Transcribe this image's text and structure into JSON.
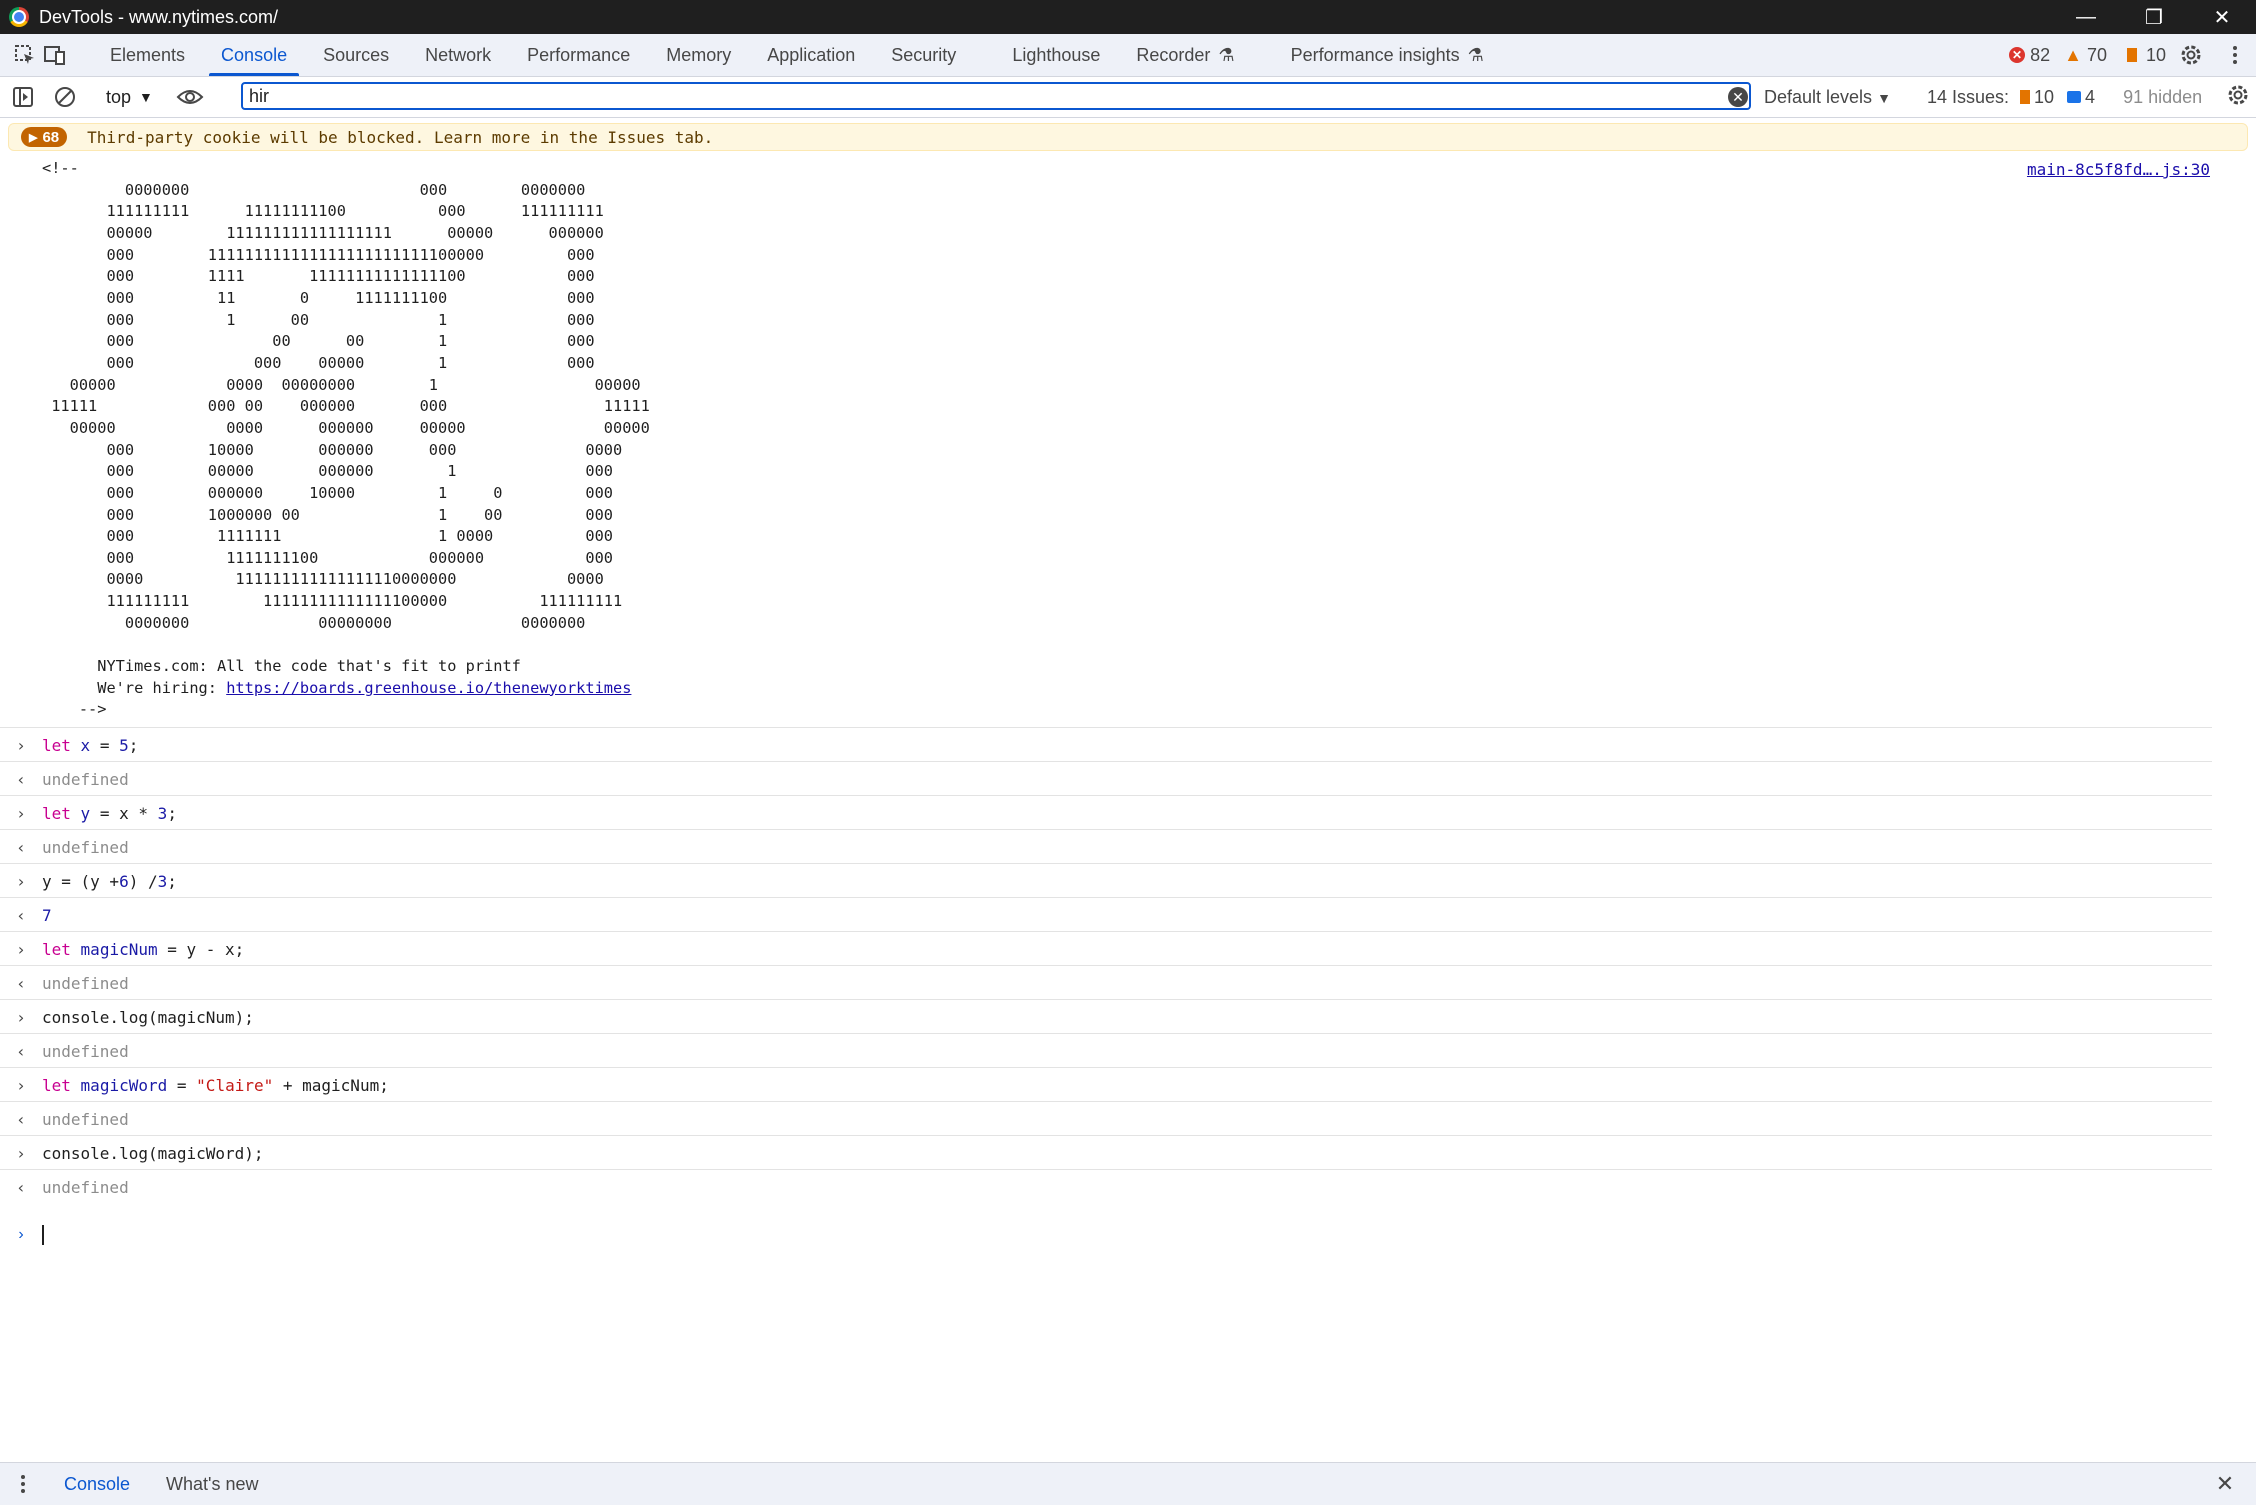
{
  "window": {
    "title": "DevTools - www.nytimes.com/"
  },
  "tabs": [
    "Elements",
    "Console",
    "Sources",
    "Network",
    "Performance",
    "Memory",
    "Application",
    "Security",
    "Lighthouse",
    "Recorder",
    "Performance insights"
  ],
  "active_tab": "Console",
  "counts": {
    "errors": "82",
    "warnings": "70",
    "issues": "10"
  },
  "toolbar": {
    "context": "top",
    "filter_value": "hir",
    "levels": "Default levels",
    "issues_label": "14 Issues:",
    "issues_warn": "10",
    "issues_info": "4",
    "hidden": "91 hidden"
  },
  "warning": {
    "count": "68",
    "text": "Third-party cookie will be blocked. Learn more in the Issues tab."
  },
  "ascii": {
    "lines": [
      "<!--",
      "         0000000                         000        0000000",
      "       111111111      11111111100          000      111111111",
      "       00000        111111111111111111      00000      000000",
      "       000        111111111111111111111111100000         000",
      "       000        1111       11111111111111100           000",
      "       000         11       0     1111111100             000",
      "       000          1      00              1             000",
      "       000               00      00        1             000",
      "       000             000    00000        1             000",
      "   00000            0000  00000000        1                 00000",
      " 11111            000 00    000000       000                 11111",
      "   00000            0000      000000     00000               00000",
      "       000        10000       000000      000              0000",
      "       000        00000       000000        1              000",
      "       000        000000     10000         1     0         000",
      "       000        1000000 00               1    00         000",
      "       000         1111111                 1 0000          000",
      "       000          1111111100            000000           000",
      "       0000          111111111111111110000000            0000",
      "       111111111        11111111111111100000          111111111",
      "         0000000              00000000              0000000",
      "",
      "      NYTimes.com: All the code that's fit to printf",
      "      We're hiring: ",
      "    -->"
    ],
    "hiring_url": "https://boards.greenhouse.io/thenewyorktimes",
    "source": "main-8c5f8fd….js:30"
  },
  "log": [
    {
      "dir": "in",
      "code": "let x = 5;"
    },
    {
      "dir": "out",
      "code": "undefined"
    },
    {
      "dir": "in",
      "code": "let y = x * 3;"
    },
    {
      "dir": "out",
      "code": "undefined"
    },
    {
      "dir": "in",
      "code": "y = (y + 6) / 3;"
    },
    {
      "dir": "out",
      "code": "7"
    },
    {
      "dir": "in",
      "code": "let magicNum = y - x;"
    },
    {
      "dir": "out",
      "code": "undefined"
    },
    {
      "dir": "in",
      "code": "console.log(magicNum);"
    },
    {
      "dir": "out",
      "code": "undefined"
    },
    {
      "dir": "in",
      "code": "let magicWord = \"Claire\" + magicNum;"
    },
    {
      "dir": "out",
      "code": "undefined"
    },
    {
      "dir": "in",
      "code": "console.log(magicWord);"
    },
    {
      "dir": "out",
      "code": "undefined"
    }
  ],
  "drawer": {
    "tab1": "Console",
    "tab2": "What's new"
  },
  "colors": {
    "accent": "#0b57d0",
    "error": "#dc362e",
    "warning": "#e37400",
    "warn_bg": "#fef7e0"
  }
}
